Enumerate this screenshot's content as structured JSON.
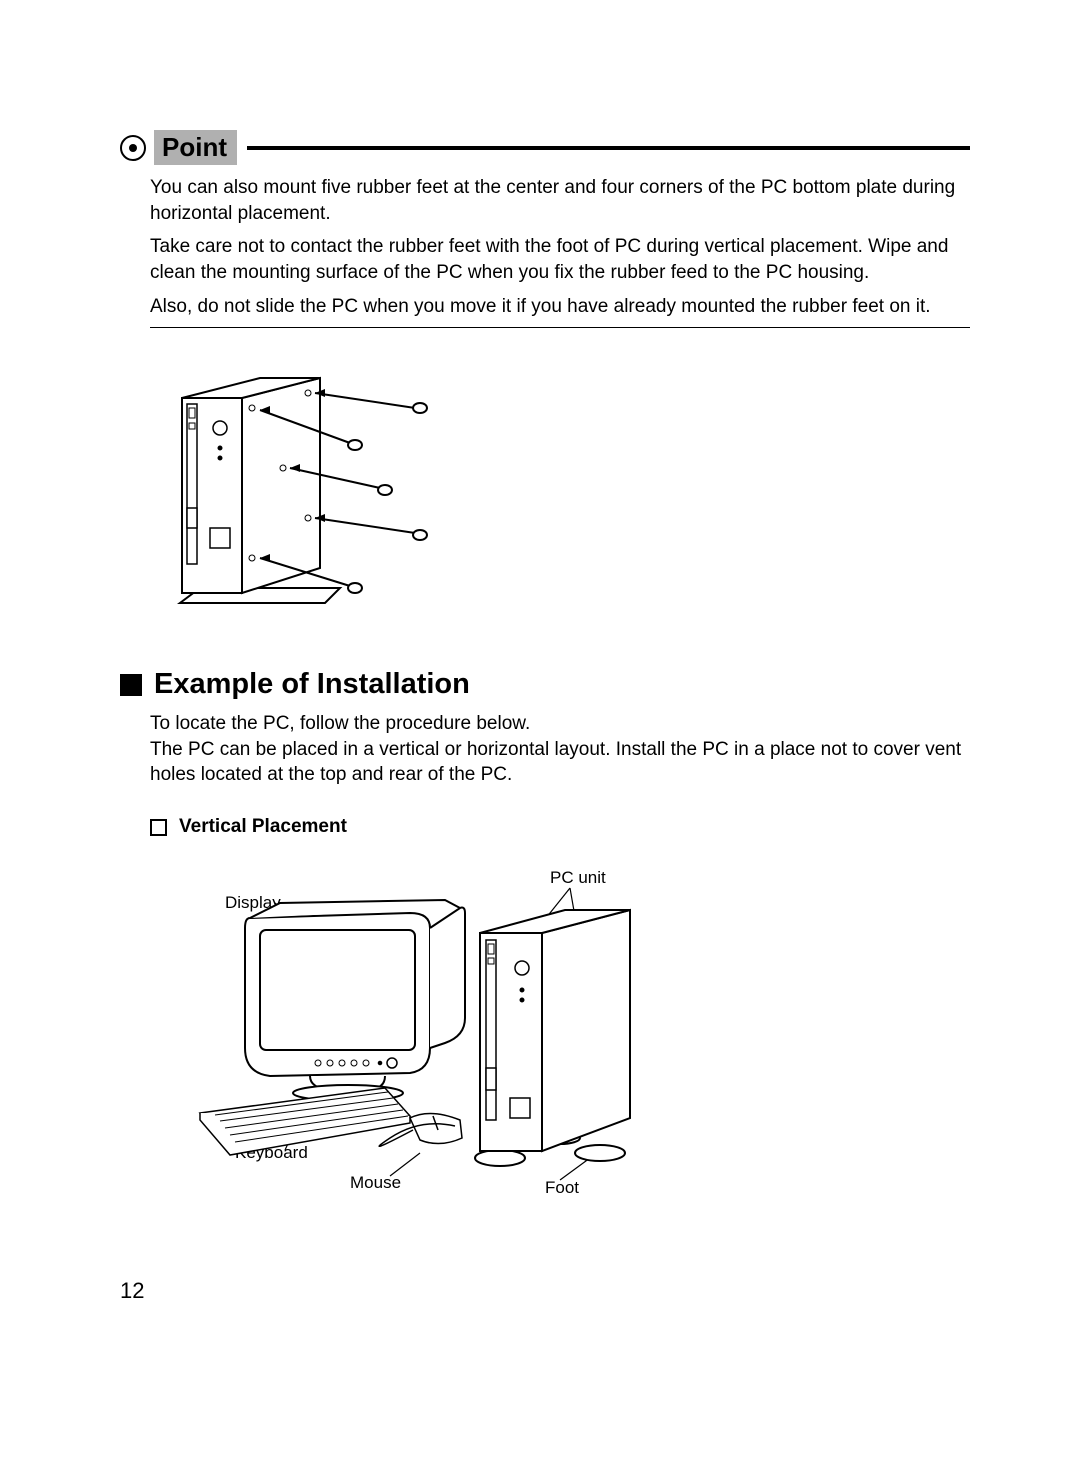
{
  "point": {
    "label": "Point",
    "paragraphs": [
      "You can also mount five rubber feet at the center and four corners of the PC bottom plate during horizontal placement.",
      "Take care not to contact the rubber feet with the foot of PC during vertical placement. Wipe and clean the mounting surface of the PC when you fix the rubber feed to the PC housing.",
      "Also, do not slide the PC when you move it if you have already mounted the rubber feet on it."
    ]
  },
  "section": {
    "heading": "Example of Installation",
    "intro": " To locate the PC, follow the procedure below.",
    "body": "The PC can be placed in a vertical or horizontal layout. Install the PC in a place not to cover vent holes located at the top and rear of the PC."
  },
  "sub": {
    "heading": "Vertical Placement"
  },
  "labels": {
    "display": "Display",
    "pcunit": "PC unit",
    "keyboard": "Keyboard",
    "mouse": "Mouse",
    "foot": "Foot"
  },
  "pageNumber": "12"
}
